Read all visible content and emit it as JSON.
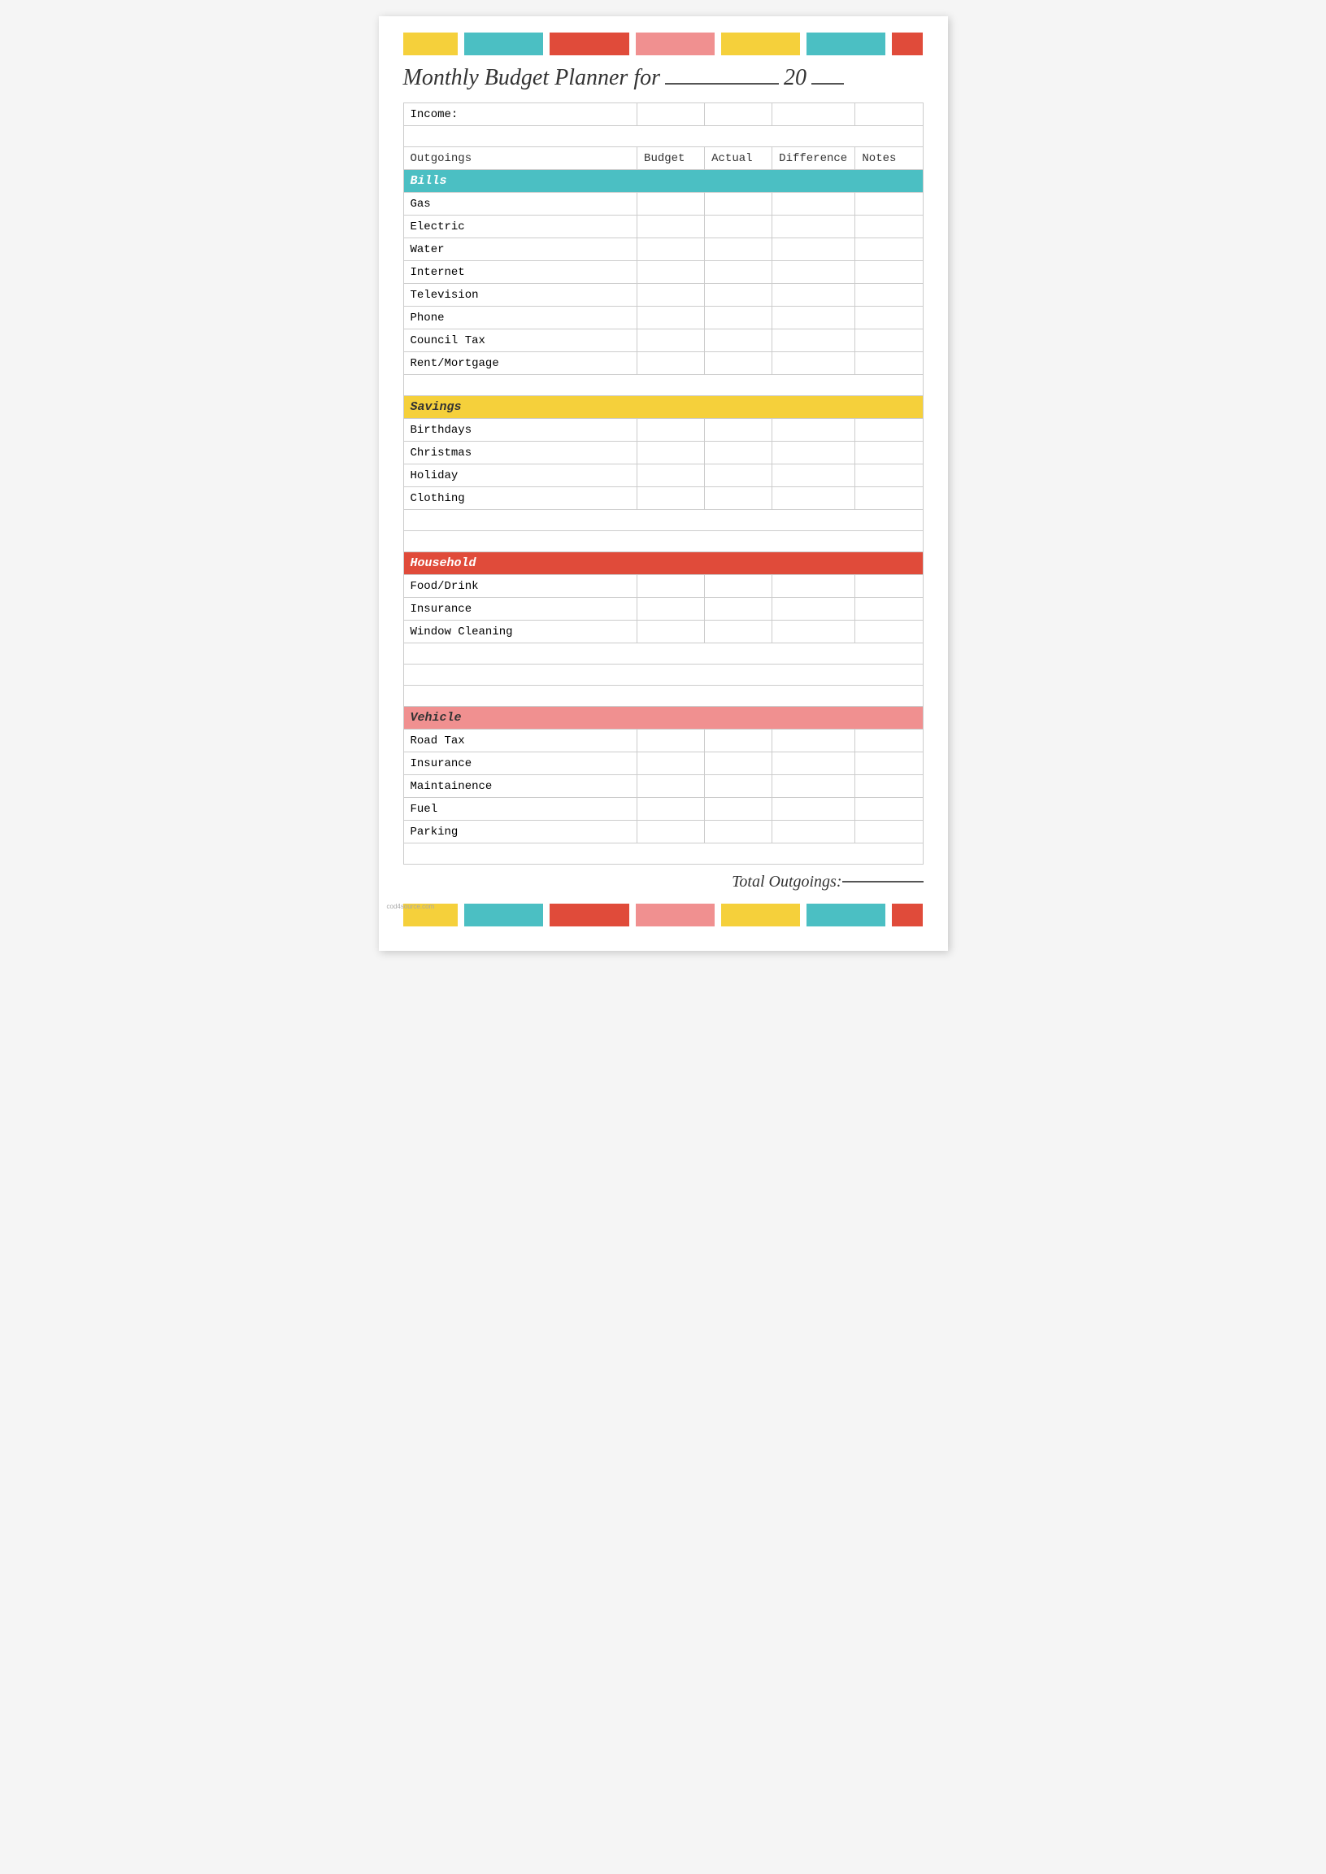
{
  "title": {
    "text": "Monthly Budget Planner for",
    "for_line": "",
    "year_prefix": "20",
    "year_line": ""
  },
  "color_bars": {
    "top": [
      "yellow",
      "teal",
      "red",
      "pink",
      "yellow",
      "teal",
      "red"
    ],
    "bottom": [
      "yellow",
      "teal",
      "red",
      "pink",
      "yellow",
      "teal",
      "red"
    ]
  },
  "table": {
    "income_label": "Income:",
    "columns": {
      "outgoings": "Outgoings",
      "budget": "Budget",
      "actual": "Actual",
      "difference": "Difference",
      "notes": "Notes"
    },
    "sections": [
      {
        "name": "Bills",
        "color": "bills",
        "items": [
          "Gas",
          "Electric",
          "Water",
          "Internet",
          "Television",
          "Phone",
          "Council Tax",
          "Rent/Mortgage"
        ]
      },
      {
        "name": "Savings",
        "color": "savings",
        "items": [
          "Birthdays",
          "Christmas",
          "Holiday",
          "Clothing"
        ]
      },
      {
        "name": "Household",
        "color": "household",
        "items": [
          "Food/Drink",
          "Insurance",
          "Window Cleaning"
        ]
      },
      {
        "name": "Vehicle",
        "color": "vehicle",
        "items": [
          "Road Tax",
          "Insurance",
          "Maintainence",
          "Fuel",
          "Parking"
        ]
      }
    ],
    "total_label": "Total Outgoings:",
    "total_line": "_____"
  },
  "watermark": "cod4source.com"
}
